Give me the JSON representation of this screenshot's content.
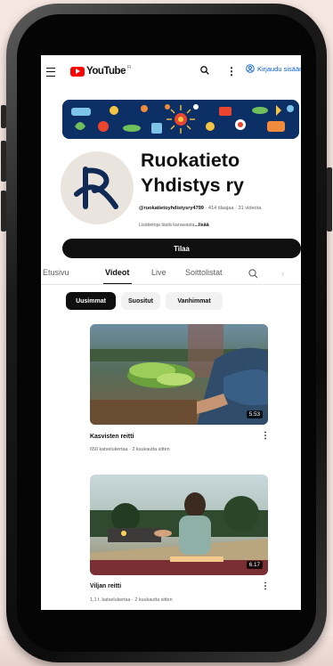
{
  "topbar": {
    "logo_text": "YouTube",
    "region": "FI",
    "signin_label": "Kirjaudu sisään"
  },
  "channel": {
    "name_line1": "Ruokatieto",
    "name_line2": "Yhdistys ry",
    "handle": "@ruokatietoyhdistysry4799",
    "subscribers": "414 tilaajaa",
    "video_count": "31 videota",
    "description": "Lisätietoja tästä kanavasta",
    "more_label": "...lisää",
    "subscribe_label": "Tilaa"
  },
  "tabs": [
    {
      "label": "Etusivu",
      "active": false
    },
    {
      "label": "Videot",
      "active": true
    },
    {
      "label": "Live",
      "active": false
    },
    {
      "label": "Soittolistat",
      "active": false
    }
  ],
  "chips": [
    {
      "label": "Uusimmat",
      "selected": true
    },
    {
      "label": "Suositut",
      "selected": false
    },
    {
      "label": "Vanhimmat",
      "selected": false
    }
  ],
  "videos": [
    {
      "title": "Kasvisten reitti",
      "views": "650 katselukertaa",
      "age": "2 kuukautta sitten",
      "duration": "5.53"
    },
    {
      "title": "Viljan reitti",
      "views": "1,1 t. katselukertaa",
      "age": "2 kuukautta sitten",
      "duration": "6.17"
    }
  ],
  "colors": {
    "brand_red": "#ff0000",
    "link_blue": "#065fd4",
    "avatar_navy": "#102a56",
    "banner_navy": "#0c2f66"
  }
}
